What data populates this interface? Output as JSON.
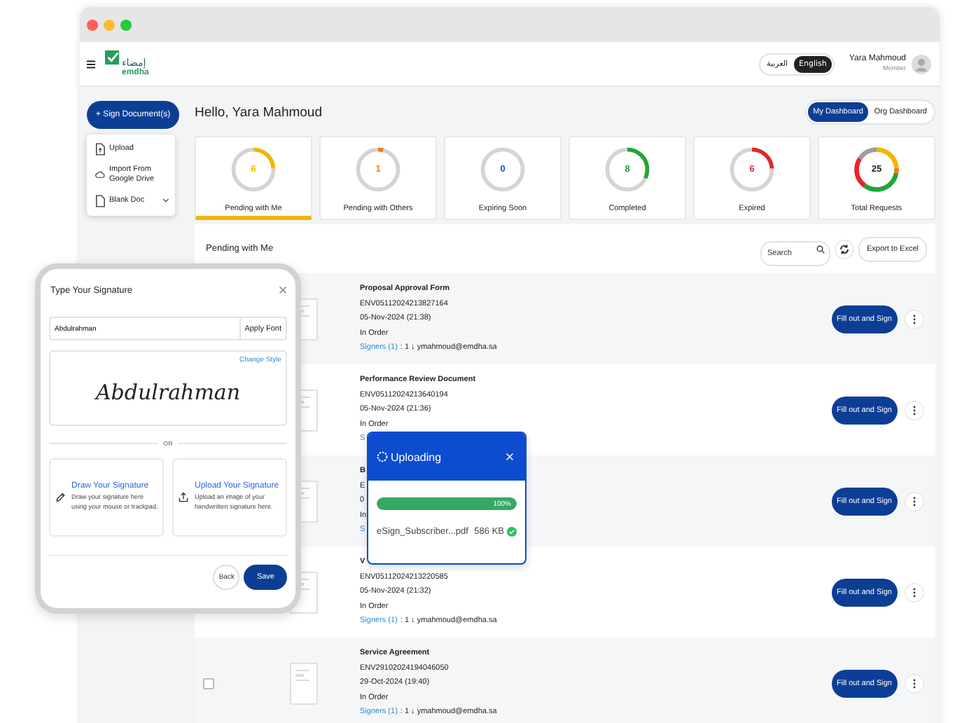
{
  "header": {
    "logo": {
      "arabic": "إمضاء",
      "latin": "emdha"
    },
    "languages": [
      {
        "label": "العربية",
        "selected": false
      },
      {
        "label": "English",
        "selected": true
      }
    ],
    "user": {
      "name": "Yara Mahmoud",
      "role": "Member"
    }
  },
  "sidebar": {
    "sign_button": "+ Sign Document(s)",
    "menu": [
      {
        "label": "Upload",
        "kind": "upload"
      },
      {
        "label": "Import From Google Drive",
        "kind": "drive"
      },
      {
        "label": "Blank Doc",
        "kind": "blank"
      }
    ]
  },
  "greeting": "Hello, Yara Mahmoud",
  "dashboard_tabs": [
    {
      "label": "My Dashboard",
      "selected": true
    },
    {
      "label": "Org Dashboard",
      "selected": false
    }
  ],
  "cards": [
    {
      "kind": "status",
      "value": "6",
      "label": "Pending with Me",
      "color": "#f2b600",
      "level": 0.24,
      "selected": true
    },
    {
      "kind": "status",
      "value": "1",
      "label": "Pending with Others",
      "color": "#f07a1a",
      "level": 0.04,
      "selected": false
    },
    {
      "kind": "status",
      "value": "0",
      "label": "Expiring Soon",
      "color": "#1d4fb8",
      "level": 0,
      "selected": false
    },
    {
      "kind": "status",
      "value": "8",
      "label": "Completed",
      "color": "#1fa637",
      "level": 0.32,
      "selected": false
    },
    {
      "kind": "status",
      "value": "6",
      "label": "Expired",
      "color": "#e5262b",
      "level": 0.24,
      "selected": false
    },
    {
      "kind": "total",
      "value": "25",
      "label": "Total Requests",
      "selected": false
    }
  ],
  "table": {
    "title": "Pending with Me",
    "search": {
      "placeholder": "Search"
    },
    "export_button": "Export to Excel",
    "rows": [
      {
        "title": "Proposal Approval Form",
        "id": "ENV05112024213827164",
        "date": "05-Nov-2024 (21:38)",
        "status": "In Order",
        "signers_link": "Signers (1)",
        "signers_detail": ": 1 ↓ ymahmoud@emdha.sa",
        "action": "Fill out and Sign"
      },
      {
        "title": "Performance Review Document",
        "id": "ENV05112024213640194",
        "date": "05-Nov-2024 (21:36)",
        "status": "In Order",
        "signers_link": "S",
        "action": "Fill out and Sign"
      },
      {
        "title": "B",
        "id": "E",
        "date": "0",
        "status": "In",
        "signers_link": "S",
        "action": "Fill out and Sign"
      },
      {
        "title": "V",
        "id": "ENV05112024213220585",
        "date": "05-Nov-2024 (21:32)",
        "status": "In Order",
        "signers_link": "Signers (1)",
        "signers_detail": ": 1 ↓ ymahmoud@emdha.sa",
        "action": "Fill out and Sign"
      },
      {
        "title": "Service Agreement",
        "id": "ENV29102024194046050",
        "date": "29-Oct-2024 (19:40)",
        "status": "In Order",
        "signers_link": "Signers (1)",
        "signers_detail": ": 1 ↓ ymahmoud@emdha.sa",
        "action": "Fill out and Sign",
        "checked": false
      }
    ]
  },
  "signature_dialog": {
    "title": "Type Your Signature",
    "name_input": "Abdulrahman",
    "apply_button": "Apply Font",
    "change_style": "Change Style",
    "signature": "Abdulrahman",
    "divider": "OR",
    "options": [
      {
        "kind": "draw",
        "title": "Draw Your Signature",
        "text": "Draw your signature here using your mouse or trackpad."
      },
      {
        "kind": "upload",
        "title": "Upload Your Signature",
        "text": "Upload an image of your handwritten signature here."
      }
    ],
    "back_button": "Back",
    "save_button": "Save"
  },
  "upload_popup": {
    "title": "Uploading",
    "level": 1,
    "percent": "100%",
    "file_name": "eSign_Subscriber...pdf",
    "file_size": "586 KB"
  }
}
